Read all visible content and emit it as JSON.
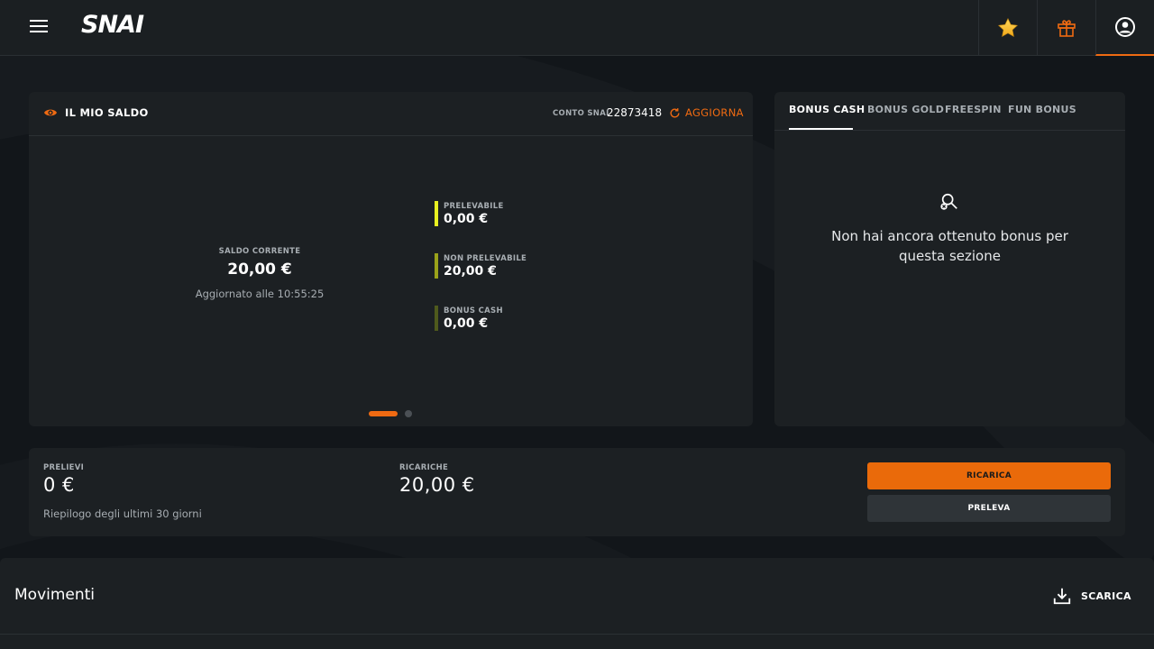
{
  "header": {
    "logo": "SNAI",
    "buttons": [
      {
        "icon": "star-icon"
      },
      {
        "icon": "gift-icon"
      },
      {
        "icon": "account-icon"
      }
    ]
  },
  "saldo": {
    "title": "IL MIO SALDO",
    "conto_label": "CONTO SNAI",
    "conto_number": "22873418",
    "refresh_label": "AGGIORNA",
    "corrente_label": "SALDO CORRENTE",
    "corrente_value": "20,00 €",
    "updated": "Aggiornato alle 10:55:25",
    "balances": [
      {
        "label": "PRELEVABILE",
        "value": "0,00 €",
        "color": "#e8f020"
      },
      {
        "label": "NON PRELEVABILE",
        "value": "20,00 €",
        "color": "#9aa21a"
      },
      {
        "label": "BONUS CASH",
        "value": "0,00 €",
        "color": "#4f5a1c"
      }
    ]
  },
  "bonus": {
    "tabs": [
      "BONUS CASH",
      "BONUS GOLD",
      "FREESPIN",
      "FUN BONUS"
    ],
    "empty_message": "Non hai ancora ottenuto bonus per questa sezione"
  },
  "summary": {
    "prelievi_label": "PRELIEVI",
    "prelievi_value": "0 €",
    "ricariche_label": "RICARICHE",
    "ricariche_value": "20,00 €",
    "note": "Riepilogo degli ultimi 30 giorni",
    "ricarica_button": "RICARICA",
    "preleva_button": "PRELEVA"
  },
  "movimenti": {
    "title": "Movimenti",
    "download_label": "SCARICA"
  },
  "colors": {
    "accent": "#ef6a12",
    "background": "#12161a",
    "card": "#1c2023"
  }
}
